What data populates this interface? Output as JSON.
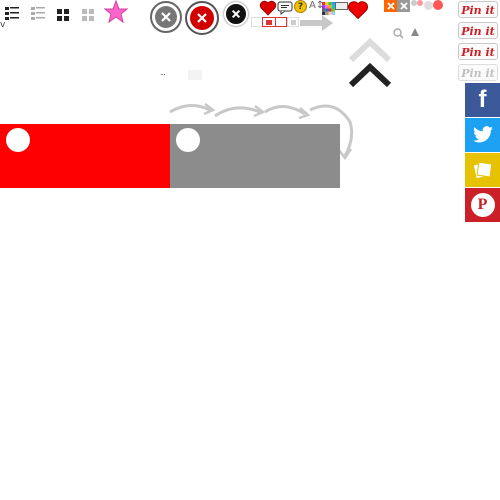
{
  "colors": {
    "toggle_on": "#ff0000",
    "toggle_off": "#8c8c8c",
    "pinterest": "#cb2027",
    "facebook": "#3b5998",
    "twitter": "#1da1f2",
    "google_bookmarks": "#e6c200",
    "pinterest_share": "#cb2027",
    "star": "#ff66cc"
  },
  "toolbar": {
    "view_icons": [
      "details-list-view-icon",
      "list-view-icon",
      "large-grid-view-icon",
      "small-grid-view-icon"
    ],
    "star_icon": "star-icon",
    "dots": "...",
    "chevron": "v"
  },
  "close_buttons": [
    "close-circle-gray-icon",
    "close-circle-red-icon",
    "close-circle-black-icon"
  ],
  "pin_it": {
    "label": "Pin it",
    "buttons": [
      {
        "label": "Pin it",
        "state": "normal"
      },
      {
        "label": "Pin it",
        "state": "normal"
      },
      {
        "label": "Pin it",
        "state": "normal"
      },
      {
        "label": "Pin it",
        "state": "disabled"
      }
    ]
  },
  "share": [
    {
      "network": "facebook",
      "icon": "facebook-icon",
      "glyph": "f"
    },
    {
      "network": "twitter",
      "icon": "twitter-icon"
    },
    {
      "network": "google-bookmarks",
      "icon": "bookmark-icon"
    },
    {
      "network": "pinterest",
      "icon": "pinterest-icon",
      "glyph": "P"
    }
  ],
  "toggles": [
    {
      "state": "on",
      "color": "#ff0000"
    },
    {
      "state": "off",
      "color": "#8c8c8c"
    }
  ],
  "misc": {
    "ellipsis": "...",
    "text_button": "A↕"
  }
}
